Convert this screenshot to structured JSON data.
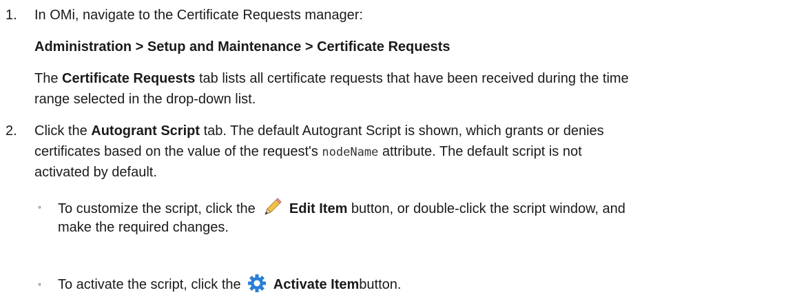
{
  "steps": [
    {
      "number": "1.",
      "intro": "In OMi, navigate to the Certificate Requests manager:",
      "path": "Administration > Setup and Maintenance > Certificate Requests",
      "desc_pre": "The ",
      "desc_bold": "Certificate Requests",
      "desc_line1_rest": " tab lists all certificate requests that have been received during the time",
      "desc_line2": "range selected in the drop-down list."
    },
    {
      "number": "2.",
      "pre": "Click the ",
      "bold": "Autogrant Script",
      "post": " tab. The default Autogrant Script is shown, which grants or denies",
      "line2_pre": "certificates based on the value of the request's ",
      "code": "nodeName",
      "line2_post": " attribute. The default script is not",
      "line3": "activated by default.",
      "bullets": [
        {
          "mark": "◦",
          "pre": "To customize the script, click the",
          "icon": "pencil-icon",
          "bold": "Edit Item",
          "post": " button, or double-click the script window, and",
          "line2": "make the required changes."
        },
        {
          "mark": "◦",
          "pre": "To activate the script, click the",
          "icon": "gear-icon",
          "bold": "Activate Item",
          "post": "button."
        }
      ]
    }
  ]
}
